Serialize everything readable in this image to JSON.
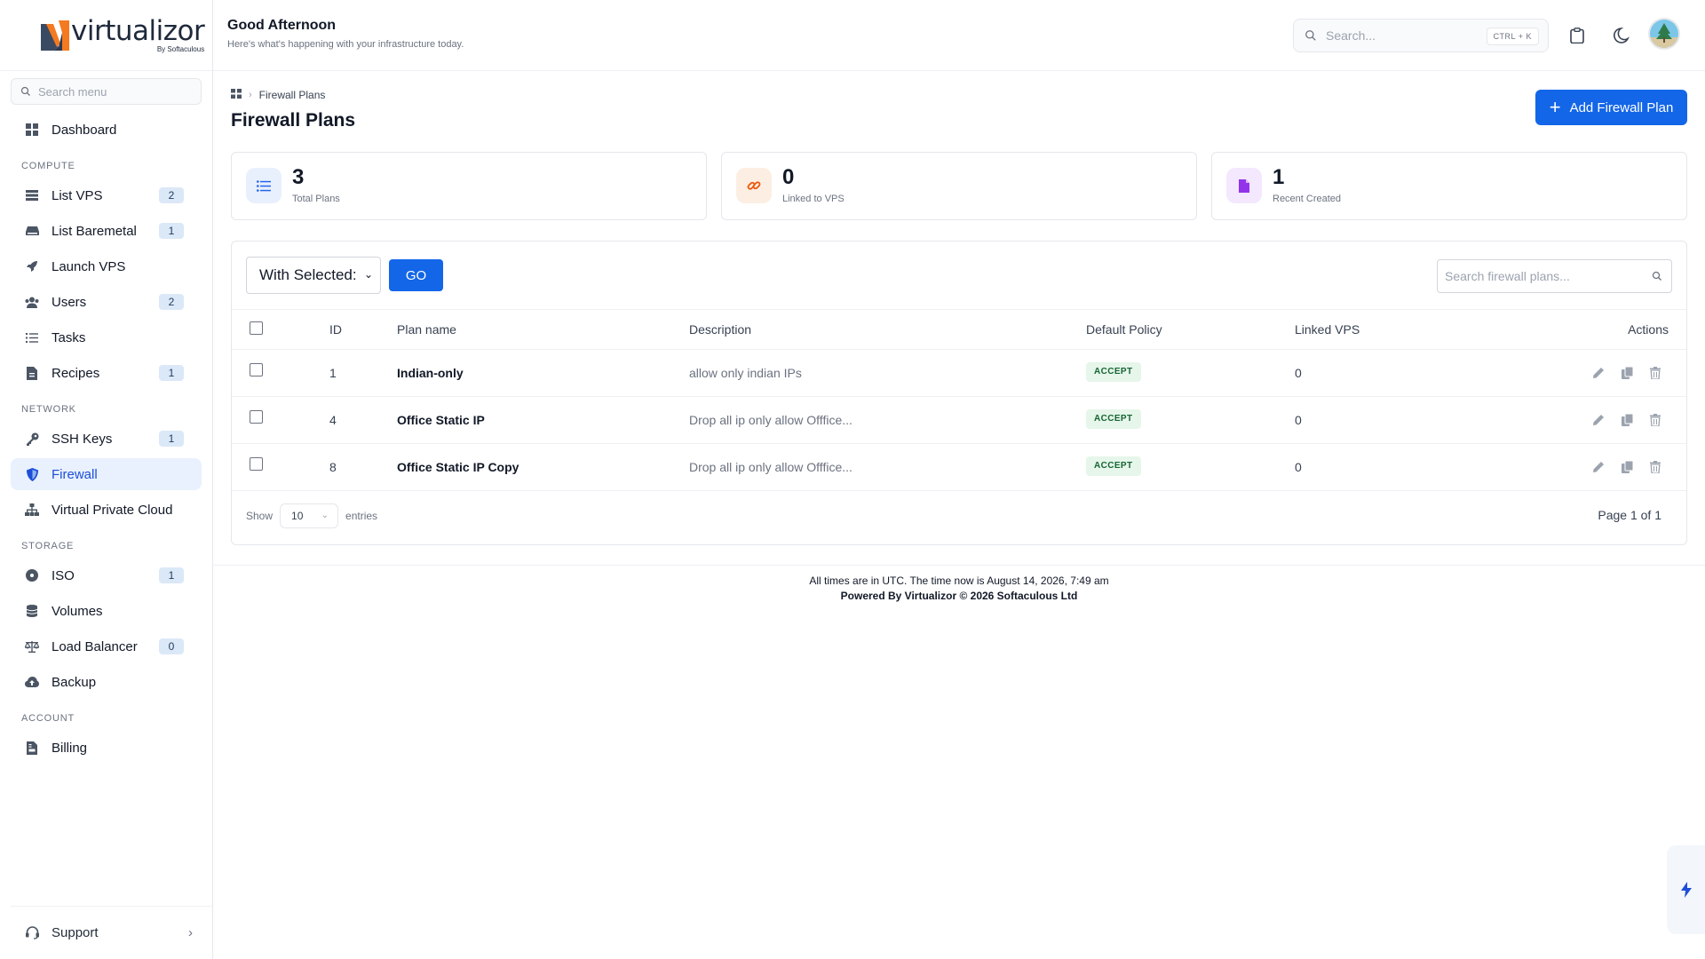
{
  "brand": {
    "name": "virtualizor",
    "by": "By Softaculous"
  },
  "sidebar": {
    "search_placeholder": "Search menu",
    "dashboard": "Dashboard",
    "sections": {
      "compute": "COMPUTE",
      "network": "NETWORK",
      "storage": "STORAGE",
      "account": "ACCOUNT"
    },
    "items": {
      "list_vps": {
        "label": "List VPS",
        "badge": "2"
      },
      "list_baremetal": {
        "label": "List Baremetal",
        "badge": "1"
      },
      "launch_vps": {
        "label": "Launch VPS"
      },
      "users": {
        "label": "Users",
        "badge": "2"
      },
      "tasks": {
        "label": "Tasks"
      },
      "recipes": {
        "label": "Recipes",
        "badge": "1"
      },
      "ssh_keys": {
        "label": "SSH Keys",
        "badge": "1"
      },
      "firewall": {
        "label": "Firewall"
      },
      "vpc": {
        "label": "Virtual Private Cloud"
      },
      "iso": {
        "label": "ISO",
        "badge": "1"
      },
      "volumes": {
        "label": "Volumes"
      },
      "load_balancer": {
        "label": "Load Balancer",
        "badge": "0"
      },
      "backup": {
        "label": "Backup"
      },
      "billing": {
        "label": "Billing"
      }
    },
    "support": "Support"
  },
  "header": {
    "greeting": "Good Afternoon",
    "subtitle": "Here's what's happening with your infrastructure today.",
    "search_placeholder": "Search...",
    "shortcut": "CTRL + K"
  },
  "page": {
    "breadcrumb": "Firewall Plans",
    "title": "Firewall Plans",
    "add_button": "Add Firewall Plan"
  },
  "stats": [
    {
      "value": "3",
      "label": "Total Plans"
    },
    {
      "value": "0",
      "label": "Linked to VPS"
    },
    {
      "value": "1",
      "label": "Recent Created"
    }
  ],
  "table": {
    "bulk_select": "With Selected:",
    "go_label": "GO",
    "search_placeholder": "Search firewall plans...",
    "columns": {
      "id": "ID",
      "name": "Plan name",
      "description": "Description",
      "policy": "Default Policy",
      "linked": "Linked VPS",
      "actions": "Actions"
    },
    "rows": [
      {
        "id": "1",
        "name": "Indian-only",
        "description": "allow only indian IPs",
        "policy": "ACCEPT",
        "linked": "0"
      },
      {
        "id": "4",
        "name": "Office Static IP",
        "description": "Drop all ip only allow Offfice...",
        "policy": "ACCEPT",
        "linked": "0"
      },
      {
        "id": "8",
        "name": "Office Static IP Copy",
        "description": "Drop all ip only allow Offfice...",
        "policy": "ACCEPT",
        "linked": "0"
      }
    ],
    "show_label": "Show",
    "page_size": "10",
    "entries_label": "entries",
    "page_info": "Page 1 of 1"
  },
  "footer": {
    "time_note": "All times are in UTC. The time now is August 14, 2026, 7:49 am",
    "powered": "Powered By Virtualizor © 2026 Softaculous Ltd"
  },
  "colors": {
    "primary": "#1366e8",
    "active_bg": "#e8f1fd",
    "accept_bg": "#e6f6ea",
    "accept_text": "#166534"
  }
}
